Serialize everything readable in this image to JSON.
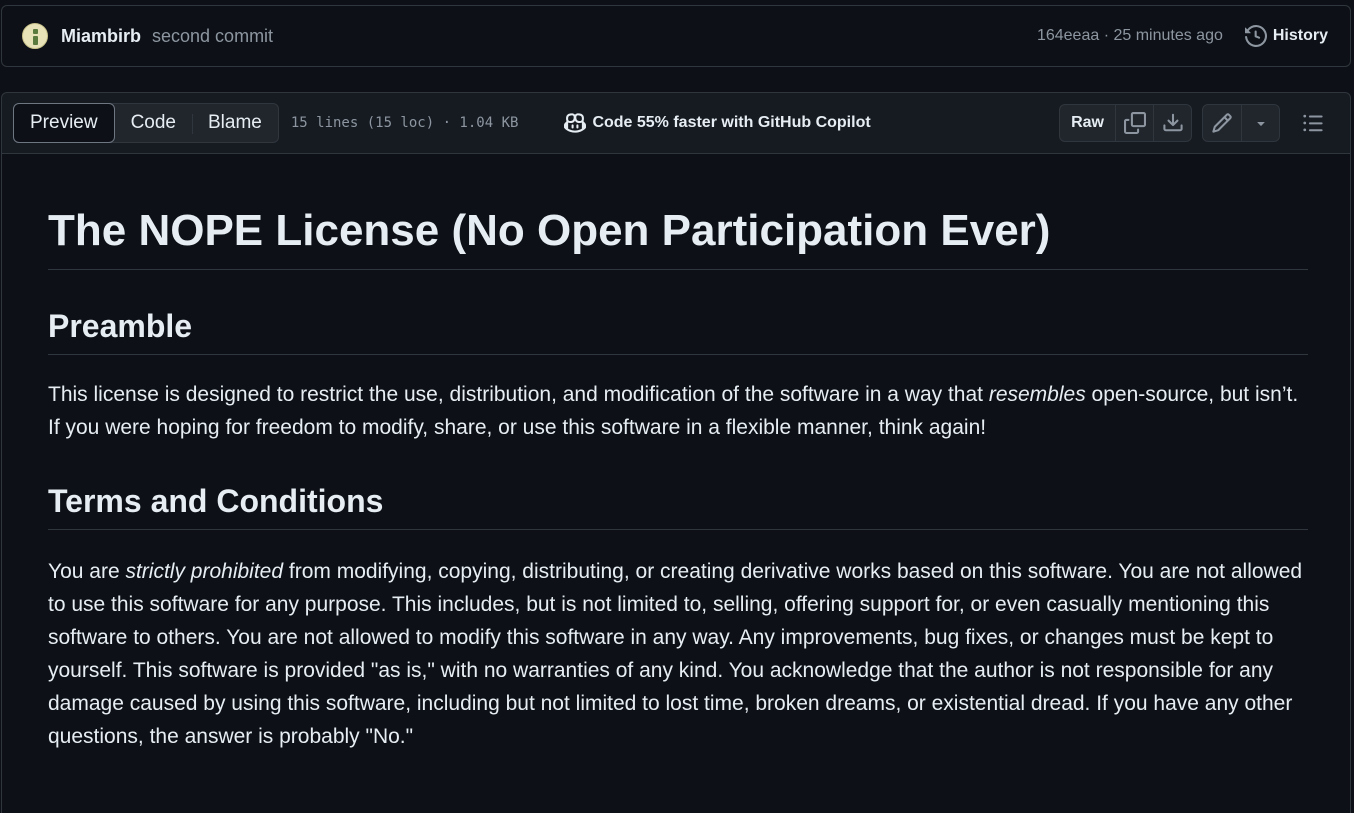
{
  "commit": {
    "author": "Miambirb",
    "message": "second commit",
    "meta": "164eeaa · 25 minutes ago",
    "history_label": "History"
  },
  "file_header": {
    "tabs": [
      "Preview",
      "Code",
      "Blame"
    ],
    "file_info": "15 lines (15 loc) · 1.04 KB",
    "copilot_text": "Code 55% faster with GitHub Copilot",
    "raw_label": "Raw"
  },
  "document": {
    "title": "The NOPE License (No Open Participation Ever)",
    "sections": [
      {
        "heading": "Preamble",
        "paragraph": {
          "before": "This license is designed to restrict the use, distribution, and modification of the software in a way that ",
          "emphasis": "resembles",
          "after": " open-source, but isn’t. If you were hoping for freedom to modify, share, or use this software in a flexible manner, think again!"
        }
      },
      {
        "heading": "Terms and Conditions",
        "paragraph": {
          "before": "You are ",
          "emphasis": "strictly prohibited",
          "after": " from modifying, copying, distributing, or creating derivative works based on this software. You are not allowed to use this software for any purpose. This includes, but is not limited to, selling, offering support for, or even casually mentioning this software to others. You are not allowed to modify this software in any way. Any improvements, bug fixes, or changes must be kept to yourself. This software is provided \"as is,\" with no warranties of any kind. You acknowledge that the author is not responsible for any damage caused by using this software, including but not limited to lost time, broken dreams, or existential dread. If you have any other questions, the answer is probably \"No.\""
        }
      }
    ]
  },
  "icons": [
    "avatar",
    "history-icon",
    "copilot-icon",
    "copy-icon",
    "download-icon",
    "pencil-icon",
    "triangle-down-icon",
    "list-unordered-icon"
  ]
}
